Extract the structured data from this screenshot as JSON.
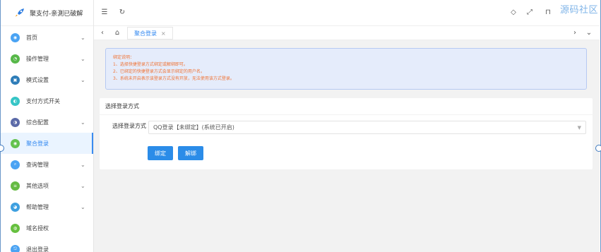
{
  "app": {
    "title": "聚支付-亲測已破解"
  },
  "watermark": "源码社区",
  "sidebar": {
    "items": [
      {
        "label": "首页",
        "color": "#4aa3f3",
        "has_children": true
      },
      {
        "label": "操作管理",
        "color": "#57b849",
        "has_children": true
      },
      {
        "label": "模式设置",
        "color": "#2e7db8",
        "has_children": true
      },
      {
        "label": "支付方式开关",
        "color": "#36c5c6",
        "has_children": false
      },
      {
        "label": "综合配置",
        "color": "#5b6aa8",
        "has_children": true
      },
      {
        "label": "聚合登录",
        "color": "#63c24f",
        "has_children": false
      },
      {
        "label": "查询管理",
        "color": "#4aa3f3",
        "has_children": true
      },
      {
        "label": "其他选项",
        "color": "#66bb44",
        "has_children": true
      },
      {
        "label": "帮助管理",
        "color": "#3ea0e0",
        "has_children": true
      },
      {
        "label": "域名授权",
        "color": "#66c03f",
        "has_children": false
      },
      {
        "label": "退出登录",
        "color": "#4aa3f3",
        "has_children": false
      }
    ]
  },
  "tabs": {
    "active_label": "聚合登录"
  },
  "notice": {
    "heading": "绑定说明：",
    "lines": [
      "1、选择快捷登录方式绑定或解绑即可。",
      "2、已绑定的快捷登录方式会显示绑定的用户名。",
      "3、系统未开启表示该登录方式没有开放，无法使用该方式登录。"
    ]
  },
  "form": {
    "card_title": "选择登录方式",
    "field_label": "选择登录方式",
    "select_value": "QQ登录【未绑定】(系统已开启)",
    "bind_button": "绑定",
    "unbind_button": "解绑"
  },
  "colors": {
    "accent": "#2e86f0",
    "notice_text": "#f07335"
  }
}
